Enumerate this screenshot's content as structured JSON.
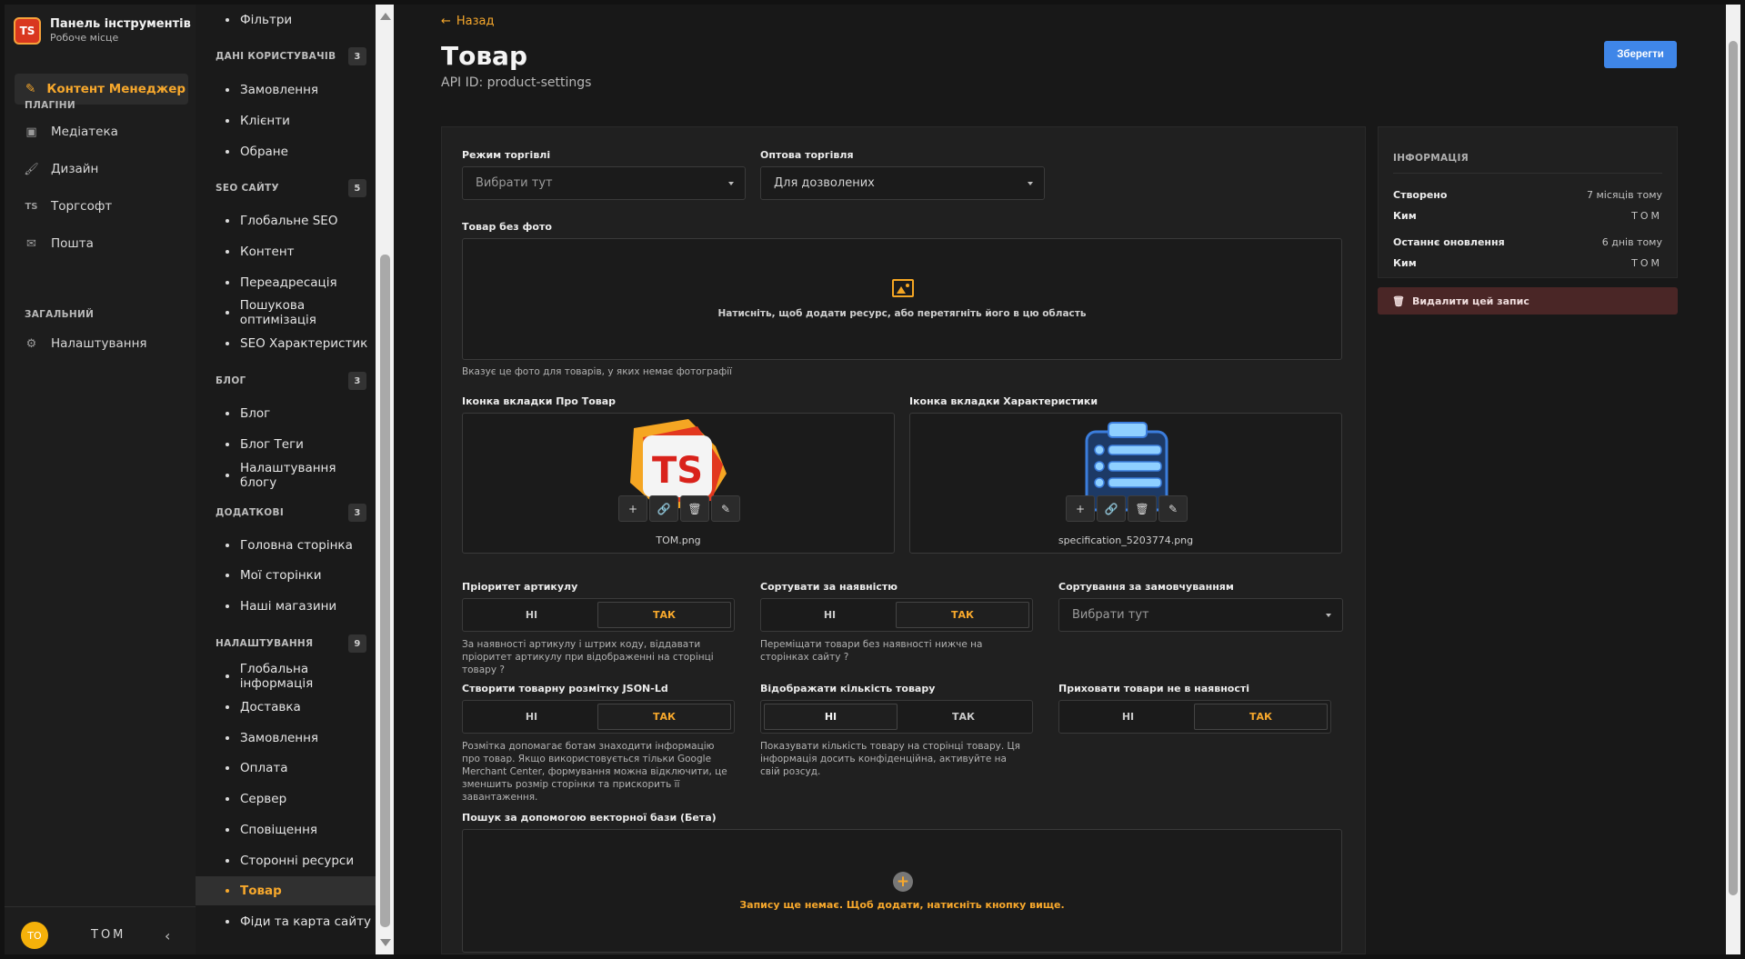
{
  "app": {
    "brand_logo": "TS",
    "brand_title": "Панель інструментів",
    "brand_subtitle": "Робоче місце"
  },
  "sidebar": {
    "active_item": "Контент Менеджер",
    "section_plugins": "ПЛАГІНИ",
    "plugins": [
      {
        "label": "Медіатека",
        "icon": "media-icon"
      },
      {
        "label": "Дизайн",
        "icon": "brush-icon"
      },
      {
        "label": "Торгсофт",
        "icon": "ts-icon"
      },
      {
        "label": "Пошта",
        "icon": "mail-icon"
      }
    ],
    "section_general": "ЗАГАЛЬНИЙ",
    "general": [
      {
        "label": "Налаштування",
        "icon": "gear-icon"
      }
    ],
    "user_initials": "TO",
    "user_name": "TOM"
  },
  "menu": {
    "top_item": "Фільтри",
    "groups": [
      {
        "title": "ДАНІ КОРИСТУВАЧІВ",
        "count": "3",
        "items": [
          "Замовлення",
          "Клієнти",
          "Обране"
        ]
      },
      {
        "title": "SEO САЙТУ",
        "count": "5",
        "items": [
          "Глобальне SEO",
          "Контент",
          "Переадресація",
          "Пошукова оптимізація",
          "SEO Характеристик"
        ]
      },
      {
        "title": "БЛОГ",
        "count": "3",
        "items": [
          "Блог",
          "Блог Теги",
          "Налаштування блогу"
        ]
      },
      {
        "title": "ДОДАТКОВІ",
        "count": "3",
        "items": [
          "Головна сторінка",
          "Мої сторінки",
          "Наші магазини"
        ]
      },
      {
        "title": "НАЛАШТУВАННЯ",
        "count": "9",
        "items": [
          "Глобальна інформація",
          "Доставка",
          "Замовлення",
          "Оплата",
          "Сервер",
          "Сповіщення",
          "Сторонні ресурси",
          "Товар",
          "Фіди та карта сайту"
        ]
      }
    ],
    "active": "Товар"
  },
  "header": {
    "back_label": "Назад",
    "title": "Товар",
    "api_id": "API ID: product-settings",
    "save_label": "Зберегти"
  },
  "form": {
    "trade_mode": {
      "label": "Режим торгівлі",
      "value": "Вибрати тут"
    },
    "wholesale": {
      "label": "Оптова торгівля",
      "value": "Для дозволених"
    },
    "no_photo": {
      "label": "Товар без фото",
      "dropzone_text": "Натисніть, щоб додати ресурс, або перетягніть його в цю область",
      "hint": "Вказує це фото для товарів, у яких немає фотографії"
    },
    "about_icon": {
      "label": "Іконка вкладки Про Товар",
      "file": "TOM.png"
    },
    "spec_icon": {
      "label": "Іконка вкладки Характеристики",
      "file": "specification_5203774.png"
    },
    "sku_priority": {
      "label": "Пріоритет артикулу",
      "no": "НІ",
      "yes": "ТАК",
      "selected": "yes",
      "hint": "За наявності артикулу і штрих коду, віддавати пріоритет артикулу при відображенні на сторінці товару ?"
    },
    "sort_stock": {
      "label": "Сортувати за наявністю",
      "no": "НІ",
      "yes": "ТАК",
      "selected": "yes",
      "hint": "Переміщати товари без наявності нижче на сторінках сайту ?"
    },
    "default_sort": {
      "label": "Сортування за замовчуванням",
      "value": "Вибрати тут"
    },
    "jsonld": {
      "label": "Створити товарну розмітку JSON-Ld",
      "no": "НІ",
      "yes": "ТАК",
      "selected": "yes",
      "hint": "Розмітка допомагає ботам знаходити інформацію про товар. Якщо використовується тільки Google Merchant Center, формування можна відключити, це зменшить розмір сторінки та прискорить її завантаження."
    },
    "show_qty": {
      "label": "Відображати кількість товару",
      "no": "НІ",
      "yes": "ТАК",
      "selected": "no",
      "hint": "Показувати кількість товару на сторінці товару. Ця інформація досить конфіденційна, активуйте на свій розсуд."
    },
    "hide_oos": {
      "label": "Приховати товари не в наявності",
      "no": "НІ",
      "yes": "ТАК",
      "selected": "yes"
    },
    "vector_search": {
      "label": "Пошук за допомогою векторної бази (Бета)",
      "empty_text": "Запису ще немає. Щоб додати, натисніть кнопку вище."
    }
  },
  "info": {
    "title": "ІНФОРМАЦІЯ",
    "created_label": "Створено",
    "created_value": "7 місяців тому",
    "created_by_label": "Ким",
    "created_by_value": "TOM",
    "updated_label": "Останнє оновлення",
    "updated_value": "6 днів тому",
    "updated_by_label": "Ким",
    "updated_by_value": "TOM",
    "delete_label": "Видалити цей запис"
  },
  "colors": {
    "accent": "#f7a82c",
    "primary_button": "#3f86e8",
    "danger_bg": "#4a2626"
  }
}
